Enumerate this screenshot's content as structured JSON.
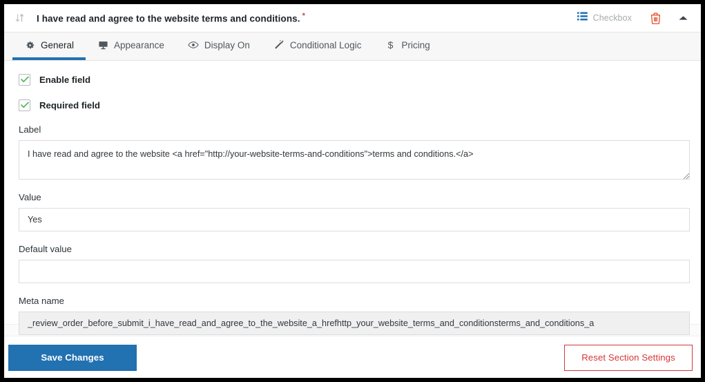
{
  "header": {
    "drag_icon": "sort-drag-icon",
    "field_title": "I have read and agree to the website terms and conditions.",
    "required_marker": "*",
    "type_icon": "list-checkbox-icon",
    "type_label": "Checkbox",
    "delete_icon": "trash-icon",
    "collapse_icon": "chevron-up-icon"
  },
  "tabs": [
    {
      "label": "General",
      "icon": "gear-icon",
      "active": true
    },
    {
      "label": "Appearance",
      "icon": "monitor-icon",
      "active": false
    },
    {
      "label": "Display On",
      "icon": "eye-icon",
      "active": false
    },
    {
      "label": "Conditional Logic",
      "icon": "magic-wand-icon",
      "active": false
    },
    {
      "label": "Pricing",
      "icon": "dollar-icon",
      "active": false
    }
  ],
  "general": {
    "enable_field": {
      "label": "Enable field",
      "checked": true
    },
    "required_field": {
      "label": "Required field",
      "checked": true
    },
    "label_field": {
      "label": "Label",
      "value": "I have read and agree to the website <a href=\"http://your-website-terms-and-conditions\">terms and conditions.</a>",
      "placeholder": ""
    },
    "value_field": {
      "label": "Value",
      "value": "Yes",
      "placeholder": ""
    },
    "default_value_field": {
      "label": "Default value",
      "value": "",
      "placeholder": ""
    },
    "meta_name_field": {
      "label": "Meta name",
      "value": "_review_order_before_submit_i_have_read_and_agree_to_the_website_a_hrefhttp_your_website_terms_and_conditionsterms_and_conditions_a",
      "placeholder": ""
    }
  },
  "footer": {
    "save_label": "Save Changes",
    "reset_label": "Reset Section Settings"
  },
  "colors": {
    "accent_blue": "#2271b1",
    "danger_red": "#d63638",
    "check_green": "#46b450",
    "muted_gray": "#a7aaad"
  }
}
